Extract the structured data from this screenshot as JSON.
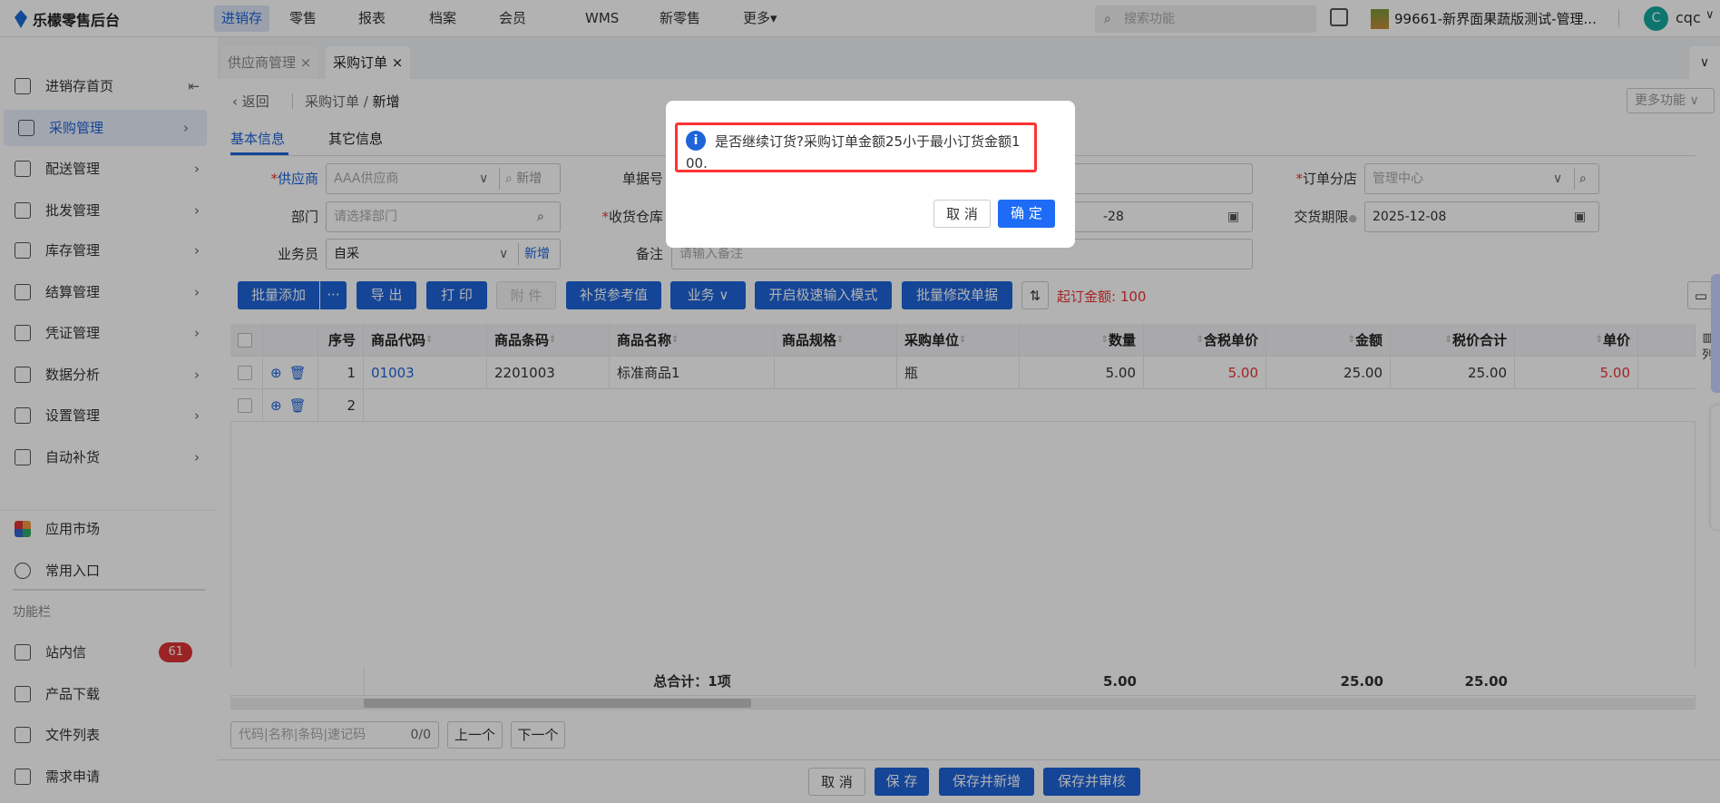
{
  "header": {
    "logo": "乐檬零售后台",
    "nav": [
      "进销存",
      "零售",
      "报表",
      "档案",
      "会员",
      "WMS",
      "新零售",
      "更多▾"
    ],
    "search_placeholder": "搜索功能",
    "store": "99661-新界面果蔬版测试-管理...",
    "avatar_letter": "C",
    "user": "cqc"
  },
  "sidebar": {
    "items": [
      {
        "label": "进销存首页",
        "icon": "home-icon"
      },
      {
        "label": "采购管理",
        "icon": "cart-icon"
      },
      {
        "label": "配送管理",
        "icon": "delivery-icon"
      },
      {
        "label": "批发管理",
        "icon": "wholesale-icon"
      },
      {
        "label": "库存管理",
        "icon": "inventory-icon"
      },
      {
        "label": "结算管理",
        "icon": "settlement-icon"
      },
      {
        "label": "凭证管理",
        "icon": "voucher-icon"
      },
      {
        "label": "数据分析",
        "icon": "chart-icon"
      },
      {
        "label": "设置管理",
        "icon": "settings-icon"
      },
      {
        "label": "自动补货",
        "icon": "replenish-icon"
      }
    ],
    "app_market": "应用市场",
    "favorites": "常用入口",
    "section": "功能栏",
    "tools": [
      {
        "label": "站内信",
        "badge": "61"
      },
      {
        "label": "产品下载"
      },
      {
        "label": "文件列表"
      },
      {
        "label": "需求申请"
      }
    ]
  },
  "tabs": [
    "供应商管理",
    "采购订单"
  ],
  "breadcrumb": {
    "back": "返回",
    "parent": "采购订单",
    "current": "新增"
  },
  "more_functions": "更多功能",
  "form_tabs": [
    "基本信息",
    "其它信息"
  ],
  "form": {
    "supplier": {
      "label": "供应商",
      "value": "AAA供应商",
      "add": "新增"
    },
    "doc_no": {
      "label": "单据号"
    },
    "branch": {
      "label": "订单分店",
      "value": "管理中心"
    },
    "dept": {
      "label": "部门",
      "placeholder": "请选择部门"
    },
    "warehouse": {
      "label": "收货仓库",
      "date": "-28"
    },
    "deadline": {
      "label": "交货期限",
      "value": "2025-12-08"
    },
    "buyer": {
      "label": "业务员",
      "value": "自采",
      "add": "新增"
    },
    "remark": {
      "label": "备注",
      "placeholder": "请输入备注"
    }
  },
  "toolbar": {
    "batch_add": "批量添加",
    "more": "···",
    "export": "导 出",
    "print": "打 印",
    "attach": "附 件",
    "replenish": "补货参考值",
    "business": "业务",
    "fast_mode": "开启极速输入模式",
    "batch_edit": "批量修改单据",
    "min_amount": "起订金额: 100",
    "min_amount_color": "#e33"
  },
  "table": {
    "headers": [
      "",
      "",
      "序号",
      "商品代码",
      "商品条码",
      "商品名称",
      "商品规格",
      "采购单位",
      "数量",
      "含税单价",
      "金额",
      "税价合计",
      "单价"
    ],
    "rows": [
      {
        "no": "1",
        "code": "01003",
        "barcode": "2201003",
        "name": "标准商品1",
        "spec": "",
        "unit": "瓶",
        "qty": "5.00",
        "tax_price": "5.00",
        "amount": "25.00",
        "total": "25.00",
        "price": "5.00"
      },
      {
        "no": "2"
      }
    ],
    "footer": {
      "label": "总合计：1项",
      "qty": "5.00",
      "amount": "25.00",
      "total": "25.00"
    },
    "column_setting": "列"
  },
  "finder": {
    "placeholder": "代码|名称|条码|速记码",
    "count": "0/0",
    "prev": "上一个",
    "next": "下一个"
  },
  "bottom": {
    "cancel": "取 消",
    "save": "保 存",
    "save_new": "保存并新增",
    "save_audit": "保存并审核"
  },
  "dialog": {
    "message": "是否继续订货?采购订单金额25小于最小订货金额100.",
    "cancel": "取 消",
    "ok": "确 定"
  },
  "colors": {
    "primary": "#1e63d8",
    "danger": "#e33"
  }
}
